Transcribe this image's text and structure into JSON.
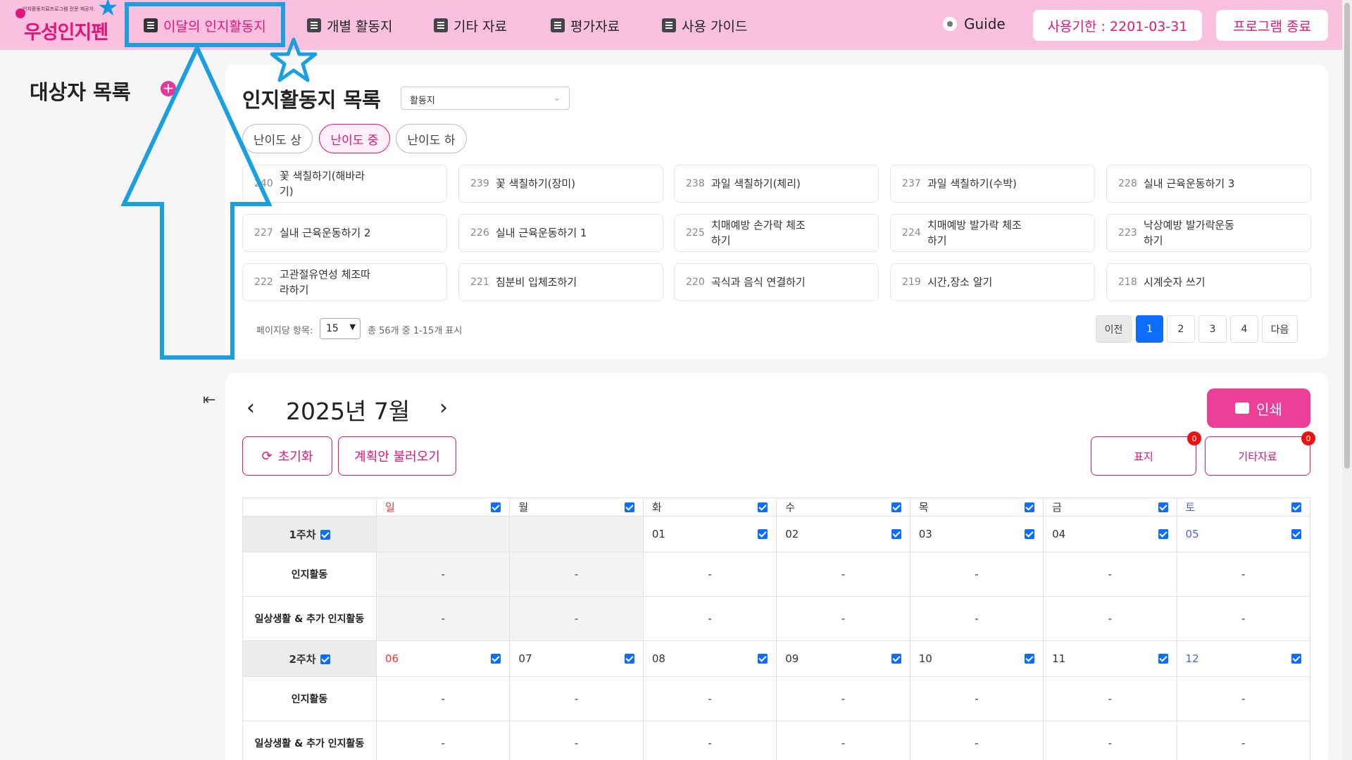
{
  "header": {
    "logo_subtitle": "인지활동치료프로그램 전문 제공처",
    "logo_text": "우성인지펜",
    "nav": [
      {
        "label": "이달의 인지활동지",
        "icon": "monthly-sheet-icon"
      },
      {
        "label": "개별 활동지",
        "icon": "document-icon"
      },
      {
        "label": "기타 자료",
        "icon": "other-material-icon"
      },
      {
        "label": "평가자료",
        "icon": "assessment-icon"
      },
      {
        "label": "사용 가이드",
        "icon": "book-icon"
      }
    ],
    "guide_label": "Guide",
    "expiry_label": "사용기한 : 2201-03-31",
    "exit_label": "프로그램 종료"
  },
  "sidebar": {
    "title": "대상자 목록",
    "add_icon": "+",
    "collapse_icon": "⇤"
  },
  "activity_list": {
    "title": "인지활동지 목록",
    "select_value": "활동지",
    "difficulty": [
      "난이도 상",
      "난이도 중",
      "난이도 하"
    ],
    "active_difficulty": "난이도 중",
    "items": [
      {
        "num": "240",
        "title": "꽃 색칠하기(해바라기)"
      },
      {
        "num": "239",
        "title": "꽃 색칠하기(장미)"
      },
      {
        "num": "238",
        "title": "과일 색칠하기(체리)"
      },
      {
        "num": "237",
        "title": "과일 색칠하기(수박)"
      },
      {
        "num": "228",
        "title": "실내 근육운동하기 3"
      },
      {
        "num": "227",
        "title": "실내 근육운동하기 2"
      },
      {
        "num": "226",
        "title": "실내 근육운동하기 1"
      },
      {
        "num": "225",
        "title": "치매예방 손가락 체조하기"
      },
      {
        "num": "224",
        "title": "치매예방 발가락 체조하기"
      },
      {
        "num": "223",
        "title": "낙상예방 발가락운동하기"
      },
      {
        "num": "222",
        "title": "고관절유연성 체조따라하기"
      },
      {
        "num": "221",
        "title": "침분비 입체조하기"
      },
      {
        "num": "220",
        "title": "곡식과 음식 연결하기"
      },
      {
        "num": "219",
        "title": "시간,장소 알기"
      },
      {
        "num": "218",
        "title": "시계숫자 쓰기"
      }
    ],
    "per_page_label": "페이지당 항목:",
    "per_page_value": "15",
    "range_info": "총 56개 중 1-15개 표시",
    "pagination": {
      "prev": "이전",
      "pages": [
        "1",
        "2",
        "3",
        "4"
      ],
      "current": "1",
      "next": "다음"
    }
  },
  "calendar": {
    "title": "2025년 7월",
    "prev_icon": "‹",
    "next_icon": "›",
    "print_label": "인쇄",
    "reset_label": "초기화",
    "load_plan_label": "계획안 불러오기",
    "cover_label": "표지",
    "cover_count": "0",
    "other_label": "기타자료",
    "other_count": "0",
    "weekdays": [
      "일",
      "월",
      "화",
      "수",
      "목",
      "금",
      "토"
    ],
    "row_labels": {
      "cognitive": "인지활동",
      "daily": "일상생활 & 추가 인지활동"
    },
    "empty_value": "-",
    "weeks": [
      {
        "label": "1주차",
        "days": [
          "",
          "",
          "01",
          "02",
          "03",
          "04",
          "05"
        ]
      },
      {
        "label": "2주차",
        "days": [
          "06",
          "07",
          "08",
          "09",
          "10",
          "11",
          "12"
        ]
      }
    ]
  },
  "colors": {
    "brand_pink": "#e3147a",
    "header_bg": "#f9c1df",
    "annotation_blue": "#1a9fe0",
    "primary_blue": "#0d6efd"
  }
}
